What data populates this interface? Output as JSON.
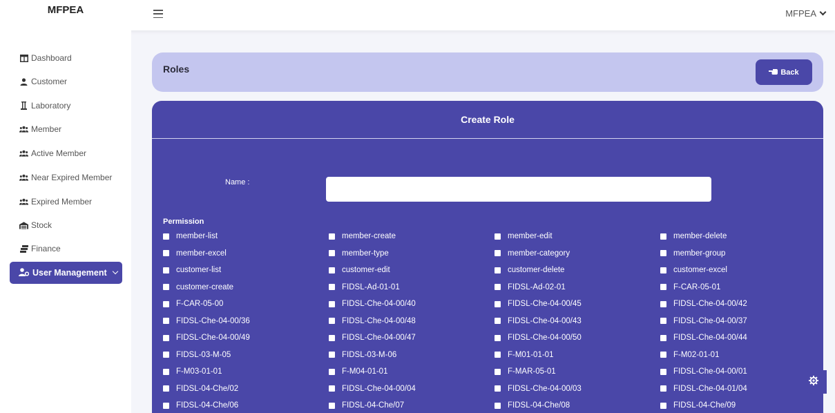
{
  "app": {
    "brand": "MFPEA"
  },
  "topbar": {
    "user_label": "MFPEA"
  },
  "sidebar": {
    "items": [
      {
        "label": "Dashboard",
        "icon": "table-icon"
      },
      {
        "label": "Customer",
        "icon": "user-icon"
      },
      {
        "label": "Laboratory",
        "icon": "flask-icon"
      },
      {
        "label": "Member",
        "icon": "users-icon"
      },
      {
        "label": "Active Member",
        "icon": "users-icon"
      },
      {
        "label": "Near Expired Member",
        "icon": "users-icon"
      },
      {
        "label": "Expired Member",
        "icon": "users-icon"
      },
      {
        "label": "Stock",
        "icon": "warehouse-icon"
      },
      {
        "label": "Finance",
        "icon": "money-icon"
      }
    ],
    "active": {
      "label": "User Management",
      "icon": "user-cog-icon"
    }
  },
  "roles_bar": {
    "title": "Roles",
    "back_label": "Back"
  },
  "form": {
    "header": "Create Role",
    "name_label": "Name :",
    "name_value": "",
    "permission_title": "Permission",
    "permissions": [
      "member-list",
      "member-create",
      "member-edit",
      "member-delete",
      "member-excel",
      "member-type",
      "member-category",
      "member-group",
      "customer-list",
      "customer-edit",
      "customer-delete",
      "customer-excel",
      "customer-create",
      "FIDSL-Ad-01-01",
      "FIDSL-Ad-02-01",
      "F-CAR-05-01",
      "F-CAR-05-00",
      "FIDSL-Che-04-00/40",
      "FIDSL-Che-04-00/45",
      "FIDSL-Che-04-00/42",
      "FIDSL-Che-04-00/36",
      "FIDSL-Che-04-00/48",
      "FIDSL-Che-04-00/43",
      "FIDSL-Che-04-00/37",
      "FIDSL-Che-04-00/49",
      "FIDSL-Che-04-00/47",
      "FIDSL-Che-04-00/50",
      "FIDSL-Che-04-00/44",
      "FIDSL-03-M-05",
      "FIDSL-03-M-06",
      "F-M01-01-01",
      "F-M02-01-01",
      "F-M03-01-01",
      "F-M04-01-01",
      "F-MAR-05-01",
      "FIDSL-Che-04-00/01",
      "FIDSL-04-Che/02",
      "FIDSL-Che-04-00/04",
      "FIDSL-Che-04-00/03",
      "FIDSL-Che-04-01/04",
      "FIDSL-04-Che/06",
      "FIDSL-04-Che/07",
      "FIDSL-04-Che/08",
      "FIDSL-04-Che/09"
    ]
  },
  "colors": {
    "primary": "#4a47a8",
    "roles_bar": "#c4c6ef",
    "background": "#f4f5fa"
  }
}
